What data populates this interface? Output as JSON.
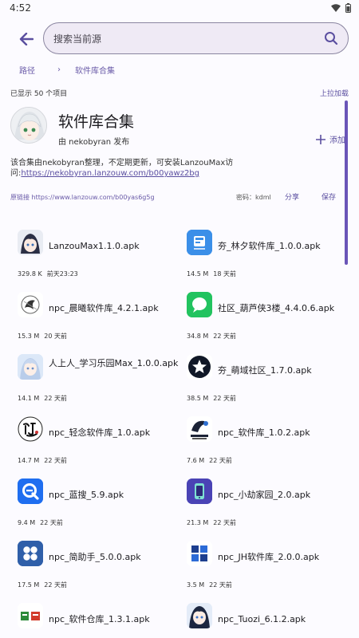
{
  "status": {
    "time": "4:52"
  },
  "search": {
    "placeholder": "搜索当前源"
  },
  "breadcrumb": {
    "root": "路径",
    "sep": "›",
    "current": "软件库合集"
  },
  "list_info": {
    "count_text": "已显示 50 个项目",
    "pull_load": "上拉加载"
  },
  "profile": {
    "title": "软件库合集",
    "author": "由 nekobyran 发布",
    "add_label": "添加"
  },
  "description": {
    "text": "该合集由nekobyran整理，不定期更新，可安装LanzouMax访问:",
    "link": "https://nekobyran.lanzouw.com/b00yawz2bg"
  },
  "link_row": {
    "orig_label": "原链接",
    "orig_url": "https://www.lanzouw.com/b00yas6g5g",
    "password": "密码：kdml",
    "share": "分享",
    "save": "保存"
  },
  "files": [
    {
      "name": "LanzouMax1.1.0.apk",
      "size": "329.8 K",
      "time": "前天23:23",
      "icon": "lanzou-avatar-icon"
    },
    {
      "name": "夯_林夕软件库_1.0.0.apk",
      "size": "14.5 M",
      "time": "18 天前",
      "icon": "linxi-icon"
    },
    {
      "name": "npc_晨曦软件库_4.2.1.apk",
      "size": "15.3 M",
      "time": "20 天前",
      "icon": "chenxi-icon"
    },
    {
      "name": "社区_葫芦侠3楼_4.4.0.6.apk",
      "size": "34.8 M",
      "time": "22 天前",
      "icon": "chat-bubble-icon"
    },
    {
      "name": "人上人_学习乐园Max_1.0.0.apk",
      "size": "14.1 M",
      "time": "22 天前",
      "icon": "anime-avatar-icon"
    },
    {
      "name": "夯_萌域社区_1.7.0.apk",
      "size": "38.5 M",
      "time": "22 天前",
      "icon": "star-badge-icon"
    },
    {
      "name": "npc_轻念软件库_1.0.apk",
      "size": "14.7 M",
      "time": "22 天前",
      "icon": "qingnian-icon"
    },
    {
      "name": "npc_软件库_1.0.2.apk",
      "size": "7.6 M",
      "time": "22 天前",
      "icon": "ruanjianku-icon"
    },
    {
      "name": "npc_蓝搜_5.9.apk",
      "size": "9.4 M",
      "time": "22 天前",
      "icon": "search-q-icon"
    },
    {
      "name": "npc_小劫家园_2.0.apk",
      "size": "21.3 M",
      "time": "22 天前",
      "icon": "phone-app-icon"
    },
    {
      "name": "npc_简助手_5.0.0.apk",
      "size": "17.5 M",
      "time": "22 天前",
      "icon": "fan-flower-icon"
    },
    {
      "name": "npc_JH软件库_2.0.0.apk",
      "size": "3.5 M",
      "time": "22 天前",
      "icon": "grid-tiles-icon"
    },
    {
      "name": "npc_软件仓库_1.3.1.apk",
      "size": "",
      "time": "",
      "icon": "warehouse-text-icon"
    },
    {
      "name": "npc_Tuozi_6.1.2.apk",
      "size": "",
      "time": "",
      "icon": "tuozi-avatar-icon"
    }
  ]
}
